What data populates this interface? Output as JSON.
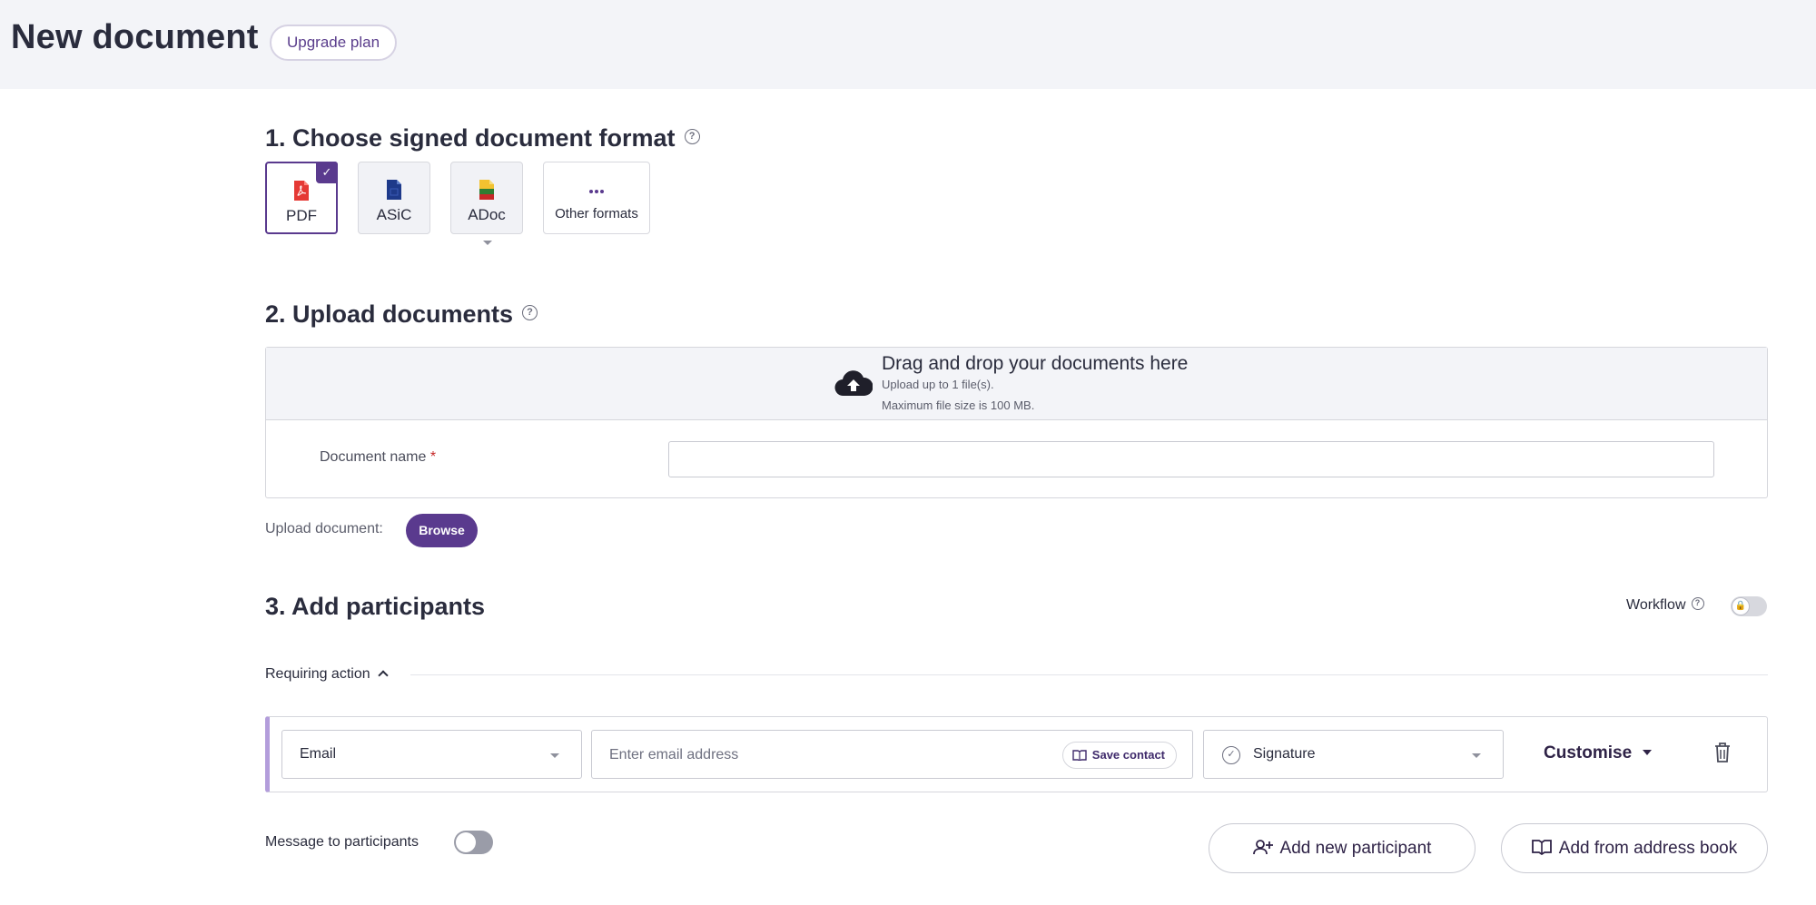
{
  "header": {
    "title": "New document",
    "upgrade_label": "Upgrade plan"
  },
  "step1": {
    "title": "1. Choose signed document format",
    "formats": [
      {
        "label": "PDF",
        "selected": true,
        "icon": "pdf-file-icon",
        "color": "#e53935"
      },
      {
        "label": "ASiC",
        "selected": false,
        "icon": "asic-file-icon",
        "color": "#1e3a8a"
      },
      {
        "label": "ADoc",
        "selected": false,
        "icon": "adoc-file-icon",
        "color": "#2e7d32"
      },
      {
        "label": "Other formats",
        "selected": false,
        "icon": "more-dots-icon",
        "color": "#5a3a8e"
      }
    ]
  },
  "step2": {
    "title": "2. Upload documents",
    "drop_title": "Drag and drop your documents here",
    "drop_limit": "Upload up to 1 file(s).",
    "drop_size": "Maximum file size is 100 MB.",
    "doc_name_label": "Document name",
    "doc_name_required": "*",
    "doc_name_value": "",
    "upload_label": "Upload document:",
    "browse_label": "Browse"
  },
  "step3": {
    "title": "3. Add participants",
    "workflow_label": "Workflow",
    "workflow_enabled": false,
    "requiring_action_label": "Requiring action",
    "participant": {
      "method_value": "Email",
      "email_placeholder": "Enter email address",
      "save_contact_label": "Save contact",
      "action_value": "Signature",
      "customise_label": "Customise"
    },
    "message_label": "Message to participants",
    "message_enabled": false,
    "add_new_label": "Add new participant",
    "add_book_label": "Add from address book"
  },
  "colors": {
    "accent": "#5a3a8e",
    "participant_stripe": "#b39ddb"
  }
}
